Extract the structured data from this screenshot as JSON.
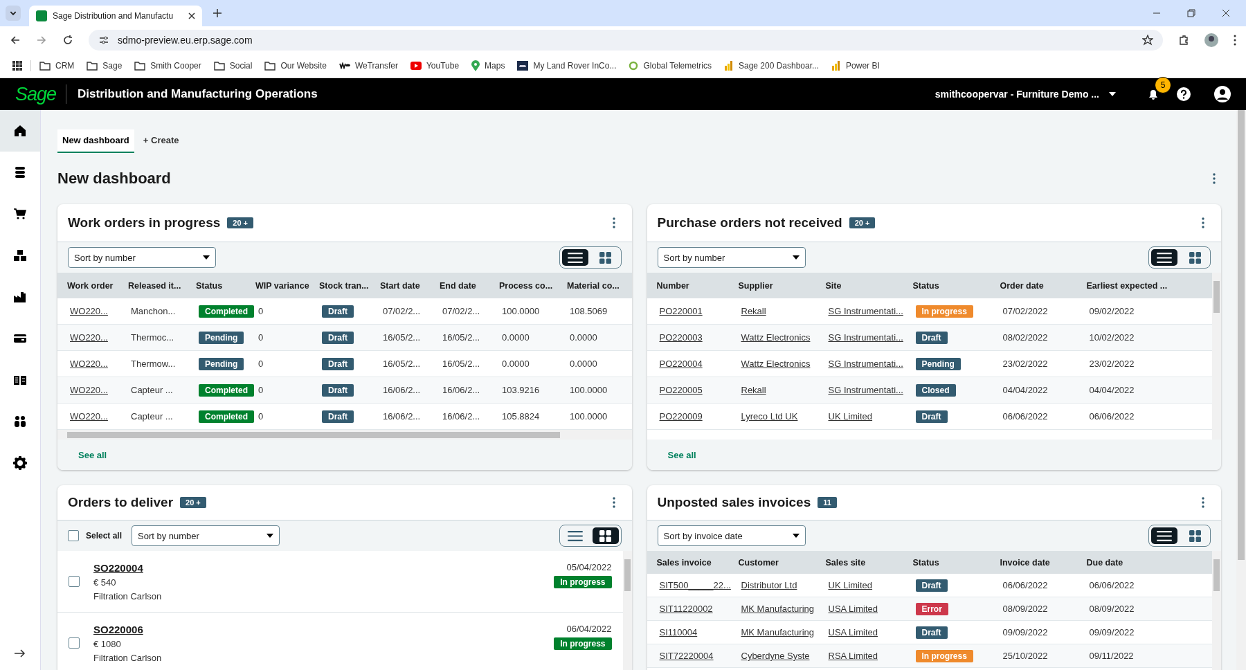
{
  "browser": {
    "tabs": [
      {
        "title": "Sage Distribution and Manufactu",
        "selected": true
      }
    ],
    "url": "sdmo-preview.eu.erp.sage.com",
    "bookmarks": [
      {
        "label": "CRM",
        "kind": "folder"
      },
      {
        "label": "Sage",
        "kind": "folder"
      },
      {
        "label": "Smith Cooper",
        "kind": "folder"
      },
      {
        "label": "Social",
        "kind": "folder"
      },
      {
        "label": "Our Website",
        "kind": "folder"
      },
      {
        "label": "WeTransfer",
        "kind": "we"
      },
      {
        "label": "YouTube",
        "kind": "youtube"
      },
      {
        "label": "Maps",
        "kind": "maps"
      },
      {
        "label": "My Land Rover InCo...",
        "kind": "car"
      },
      {
        "label": "Global Telemetrics",
        "kind": "g"
      },
      {
        "label": "Sage 200 Dashboar...",
        "kind": "chart"
      },
      {
        "label": "Power BI",
        "kind": "chart"
      }
    ]
  },
  "app": {
    "logo": "Sage",
    "title": "Distribution and Manufacturing Operations",
    "company": "smithcoopervar - Furniture Demo ...",
    "notifications": "5"
  },
  "sidebar": {
    "items": [
      {
        "kind": "home",
        "selected": true
      },
      {
        "kind": "stack",
        "selected": false
      },
      {
        "kind": "cart",
        "selected": false
      },
      {
        "kind": "boxes",
        "selected": false
      },
      {
        "kind": "factory",
        "selected": false
      },
      {
        "kind": "card",
        "selected": false
      },
      {
        "kind": "ledger",
        "selected": false
      },
      {
        "kind": "people",
        "selected": false
      },
      {
        "kind": "gear",
        "selected": false
      }
    ]
  },
  "dashboard_tabs": [
    {
      "label": "New dashboard",
      "selected": true
    },
    {
      "label": "+ Create",
      "selected": false
    }
  ],
  "heading": "New dashboard",
  "widgets": [
    {
      "kind": "table",
      "title": "Work orders in progress",
      "count": "20 +",
      "sort": "Sort by number",
      "view_buttons": [
        {
          "kind": "list",
          "selected": true
        },
        {
          "kind": "grid",
          "selected": false
        }
      ],
      "see_all": "See all",
      "hscroll": true,
      "columns": [
        {
          "label": "Work order",
          "kind": "link"
        },
        {
          "label": "Released it...",
          "kind": "text"
        },
        {
          "label": "Status",
          "kind": "badge"
        },
        {
          "label": "WIP variance",
          "kind": "text"
        },
        {
          "label": "Stock tran...",
          "kind": "badge"
        },
        {
          "label": "Start date",
          "kind": "text"
        },
        {
          "label": "End date",
          "kind": "text"
        },
        {
          "label": "Process co...",
          "kind": "text"
        },
        {
          "label": "Material co...",
          "kind": "text"
        }
      ],
      "rows": [
        [
          {
            "text": "WO220..."
          },
          {
            "text": "Manchon..."
          },
          {
            "text": "Completed",
            "color": "#00812d"
          },
          {
            "text": "0"
          },
          {
            "text": "Draft",
            "color": "#335b70"
          },
          {
            "text": "07/02/2..."
          },
          {
            "text": "07/02/2..."
          },
          {
            "text": "100.0000"
          },
          {
            "text": "108.5069"
          }
        ],
        [
          {
            "text": "WO220..."
          },
          {
            "text": "Thermoc..."
          },
          {
            "text": "Pending",
            "color": "#335b70"
          },
          {
            "text": "0"
          },
          {
            "text": "Draft",
            "color": "#335b70"
          },
          {
            "text": "16/05/2..."
          },
          {
            "text": "16/05/2..."
          },
          {
            "text": "0.0000"
          },
          {
            "text": "0.0000"
          }
        ],
        [
          {
            "text": "WO220..."
          },
          {
            "text": "Thermow..."
          },
          {
            "text": "Pending",
            "color": "#335b70"
          },
          {
            "text": "0"
          },
          {
            "text": "Draft",
            "color": "#335b70"
          },
          {
            "text": "16/05/2..."
          },
          {
            "text": "16/05/2..."
          },
          {
            "text": "0.0000"
          },
          {
            "text": "0.0000"
          }
        ],
        [
          {
            "text": "WO220..."
          },
          {
            "text": "Capteur ..."
          },
          {
            "text": "Completed",
            "color": "#00812d"
          },
          {
            "text": "0"
          },
          {
            "text": "Draft",
            "color": "#335b70"
          },
          {
            "text": "16/06/2..."
          },
          {
            "text": "16/06/2..."
          },
          {
            "text": "103.9216"
          },
          {
            "text": "100.0000"
          }
        ],
        [
          {
            "text": "WO220..."
          },
          {
            "text": "Capteur ..."
          },
          {
            "text": "Completed",
            "color": "#00812d"
          },
          {
            "text": "0"
          },
          {
            "text": "Draft",
            "color": "#335b70"
          },
          {
            "text": "16/06/2..."
          },
          {
            "text": "16/06/2..."
          },
          {
            "text": "105.8824"
          },
          {
            "text": "100.0000"
          }
        ]
      ]
    },
    {
      "kind": "table",
      "title": "Purchase orders not received",
      "count": "20 +",
      "sort": "Sort by number",
      "view_buttons": [
        {
          "kind": "list",
          "selected": true
        },
        {
          "kind": "grid",
          "selected": false
        }
      ],
      "see_all": "See all",
      "hscroll": false,
      "columns": [
        {
          "label": "Number",
          "kind": "link"
        },
        {
          "label": "Supplier",
          "kind": "link"
        },
        {
          "label": "Site",
          "kind": "link"
        },
        {
          "label": "Status",
          "kind": "badge"
        },
        {
          "label": "Order date",
          "kind": "text"
        },
        {
          "label": "Earliest expected ...",
          "kind": "text"
        }
      ],
      "rows": [
        [
          {
            "text": "PO220001"
          },
          {
            "text": "Rekall"
          },
          {
            "text": "SG Instrumentati..."
          },
          {
            "text": "In progress",
            "color": "#ef8a2c"
          },
          {
            "text": "07/02/2022"
          },
          {
            "text": "09/02/2022"
          }
        ],
        [
          {
            "text": "PO220003"
          },
          {
            "text": "Wattz Electronics"
          },
          {
            "text": "SG Instrumentati..."
          },
          {
            "text": "Draft",
            "color": "#335b70"
          },
          {
            "text": "08/02/2022"
          },
          {
            "text": "10/02/2022"
          }
        ],
        [
          {
            "text": "PO220004"
          },
          {
            "text": "Wattz Electronics"
          },
          {
            "text": "SG Instrumentati..."
          },
          {
            "text": "Pending",
            "color": "#335b70"
          },
          {
            "text": "23/02/2022"
          },
          {
            "text": "23/02/2022"
          }
        ],
        [
          {
            "text": "PO220005"
          },
          {
            "text": "Rekall"
          },
          {
            "text": "SG Instrumentati..."
          },
          {
            "text": "Closed",
            "color": "#335b70"
          },
          {
            "text": "04/04/2022"
          },
          {
            "text": "04/04/2022"
          }
        ],
        [
          {
            "text": "PO220009"
          },
          {
            "text": "Lyreco Ltd UK"
          },
          {
            "text": "UK Limited"
          },
          {
            "text": "Draft",
            "color": "#335b70"
          },
          {
            "text": "06/06/2022"
          },
          {
            "text": "06/06/2022"
          }
        ]
      ]
    },
    {
      "kind": "cards",
      "title": "Orders to deliver",
      "count": "20 +",
      "select_all": {
        "label": "Select all",
        "checked": false
      },
      "sort": "Sort by number",
      "view_buttons": [
        {
          "kind": "list",
          "selected": false
        },
        {
          "kind": "grid",
          "selected": true
        }
      ],
      "items": [
        {
          "number": "SO220004",
          "amount": "€ 540",
          "customer": "Filtration Carlson",
          "date": "05/04/2022",
          "status": {
            "text": "In progress",
            "color": "#00812d"
          },
          "checked": false
        },
        {
          "number": "SO220006",
          "amount": "€ 1080",
          "customer": "Filtration Carlson",
          "date": "06/04/2022",
          "status": {
            "text": "In progress",
            "color": "#00812d"
          },
          "checked": false
        }
      ]
    },
    {
      "kind": "table",
      "title": "Unposted sales invoices",
      "count": "11",
      "sort": "Sort by invoice date",
      "view_buttons": [
        {
          "kind": "list",
          "selected": true
        },
        {
          "kind": "grid",
          "selected": false
        }
      ],
      "hscroll": false,
      "columns": [
        {
          "label": "Sales invoice",
          "kind": "link"
        },
        {
          "label": "Customer",
          "kind": "link"
        },
        {
          "label": "Sales site",
          "kind": "link"
        },
        {
          "label": "Status",
          "kind": "badge"
        },
        {
          "label": "Invoice date",
          "kind": "text"
        },
        {
          "label": "Due date",
          "kind": "text"
        }
      ],
      "rows": [
        [
          {
            "text": "SIT500_____22..."
          },
          {
            "text": "Distributor Ltd"
          },
          {
            "text": "UK Limited"
          },
          {
            "text": "Draft",
            "color": "#335b70"
          },
          {
            "text": "06/06/2022"
          },
          {
            "text": "06/06/2022"
          }
        ],
        [
          {
            "text": "SIT11220002"
          },
          {
            "text": "MK Manufacturing"
          },
          {
            "text": "USA Limited"
          },
          {
            "text": "Error",
            "color": "#cd384b"
          },
          {
            "text": "08/09/2022"
          },
          {
            "text": "08/09/2022"
          }
        ],
        [
          {
            "text": "SI110004"
          },
          {
            "text": "MK Manufacturing"
          },
          {
            "text": "USA Limited"
          },
          {
            "text": "Draft",
            "color": "#335b70"
          },
          {
            "text": "09/09/2022"
          },
          {
            "text": "09/09/2022"
          }
        ],
        [
          {
            "text": "SIT72220004"
          },
          {
            "text": "Cyberdyne Syste"
          },
          {
            "text": "RSA Limited"
          },
          {
            "text": "In progress",
            "color": "#ef8a2c"
          },
          {
            "text": "25/10/2022"
          },
          {
            "text": "09/11/2022"
          }
        ]
      ]
    }
  ]
}
